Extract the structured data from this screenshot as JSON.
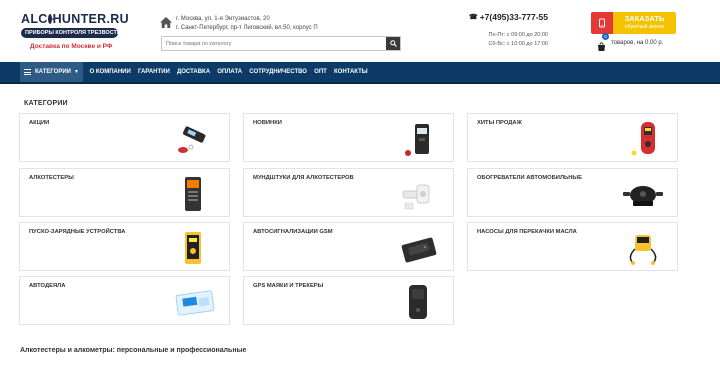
{
  "header": {
    "logo_left": "ALC",
    "logo_right": "HUNTER.RU",
    "logo_tagline": "ПРИБОРЫ КОНТРОЛЯ ТРЕЗВОСТИ",
    "delivery": "Доставка по Москве и РФ",
    "address_line1": "г. Москва, ул. 1-я Энтузиастов, 20",
    "address_line2": "г. Санкт-Петербург, пр-т Лиговский, вл.50, корпус П",
    "search_placeholder": "Поиск товара по каталогу",
    "phone": "+7(495)33-777-55",
    "hours_line1": "Пн-Пт: с 09:00 до 20:00",
    "hours_line2": "Сб-Вс: с 10:00 до 17:00",
    "order_main": "Заказать",
    "order_sub": "обратный звонок",
    "cart_count": "0",
    "cart_text": "товаров, на 0.00 р."
  },
  "nav": {
    "catalog": "Категории",
    "items": [
      "О компании",
      "Гарантии",
      "Доставка",
      "Оплата",
      "Сотрудничество",
      "Опт",
      "Контакты"
    ]
  },
  "main": {
    "section_title": "КАТЕГОРИИ",
    "categories": [
      {
        "label": "АКЦИИ",
        "icon": "breathalyzer-keychain-icon"
      },
      {
        "label": "НОВИНКИ",
        "icon": "breathalyzer-device-icon"
      },
      {
        "label": "ХИТЫ ПРОДАЖ",
        "icon": "red-breathalyzer-icon"
      },
      {
        "label": "АЛКОТЕСТЕРЫ",
        "icon": "breathalyzer-handheld-icon"
      },
      {
        "label": "МУНДШТУКИ ДЛЯ АЛКОТЕСТЕРОВ",
        "icon": "mouthpiece-icon"
      },
      {
        "label": "ОБОГРЕВАТЕЛИ АВТОМОБИЛЬНЫЕ",
        "icon": "car-heater-icon"
      },
      {
        "label": "ПУСКО-ЗАРЯДНЫЕ УСТРОЙСТВА",
        "icon": "jump-starter-icon"
      },
      {
        "label": "АВТОСИГНАЛИЗАЦИИ GSM",
        "icon": "gsm-alarm-icon"
      },
      {
        "label": "НАСОСЫ ДЛЯ ПЕРЕКАЧКИ МАСЛА",
        "icon": "oil-pump-icon"
      },
      {
        "label": "АВТОДЕЯЛА",
        "icon": "car-blanket-icon"
      },
      {
        "label": "GPS МАЯКИ И ТРЕКЕРЫ",
        "icon": "gps-tracker-icon"
      }
    ],
    "bottom_heading": "Алкотестеры и алкометры: персональные и профессиональные"
  },
  "colors": {
    "nav_bg": "#0b3b66",
    "nav_active": "#2e5a86",
    "accent_red": "#d32f2f",
    "order_yellow": "#f5c200"
  }
}
